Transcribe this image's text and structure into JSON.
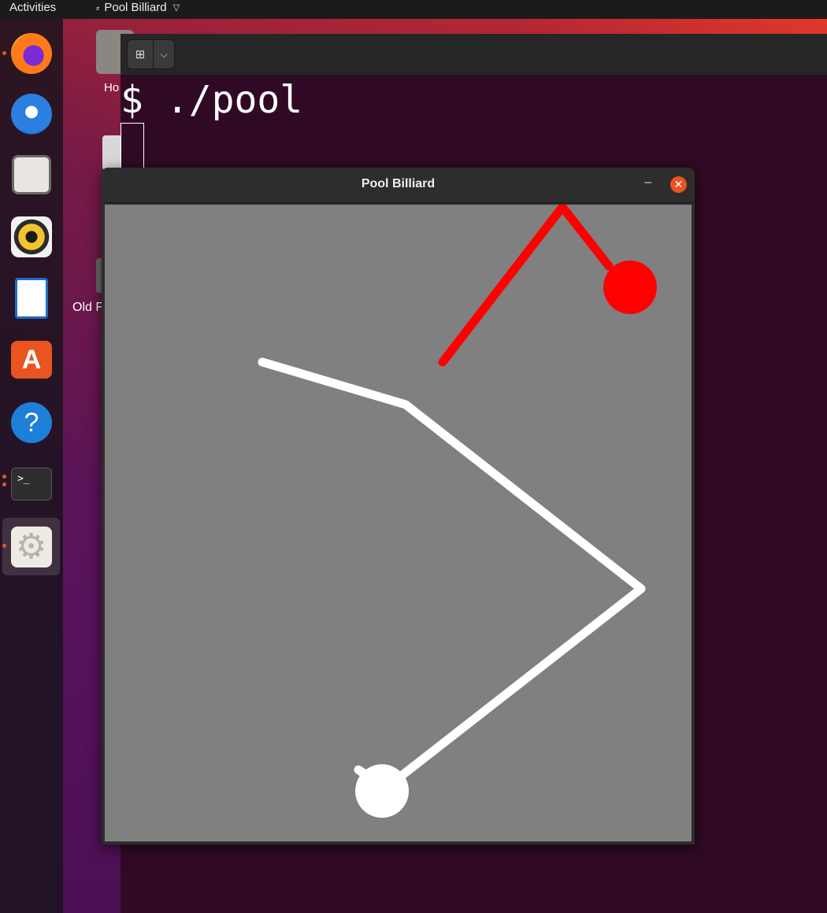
{
  "topbar": {
    "activities": "Activities",
    "app_name": "Pool Billiard",
    "app_icon": "scatter-icon"
  },
  "dock": {
    "items": [
      {
        "name": "firefox",
        "icon": "firefox-icon",
        "running": true
      },
      {
        "name": "thunderbird",
        "icon": "thunderbird-icon",
        "running": false
      },
      {
        "name": "files",
        "icon": "files-icon",
        "running": false
      },
      {
        "name": "rhythmbox",
        "icon": "rhythmbox-icon",
        "running": false
      },
      {
        "name": "libreoffice-writer",
        "icon": "writer-icon",
        "running": false
      },
      {
        "name": "ubuntu-software",
        "icon": "software-store-icon",
        "running": false
      },
      {
        "name": "help",
        "icon": "help-icon",
        "running": false
      },
      {
        "name": "terminal",
        "icon": "terminal-icon",
        "running": true
      },
      {
        "name": "pool-billiard",
        "icon": "gear-icon",
        "running": true,
        "active": true
      }
    ]
  },
  "desktop": {
    "home_label": "Ho",
    "old_label": "Old F"
  },
  "terminal": {
    "command": "$ ./pool",
    "glyphs": {
      "new_tab": "⊞",
      "dropdown": "⌵",
      "prompt": ">_"
    }
  },
  "pool_window": {
    "title": "Pool Billiard",
    "minimize": "–",
    "close": "✕",
    "colors": {
      "table": "#808080",
      "cue_ball": "#ffffff",
      "target_ball": "#ff0000"
    }
  },
  "glyphs": {
    "help": "?",
    "store": "A",
    "gear": "⚙"
  }
}
